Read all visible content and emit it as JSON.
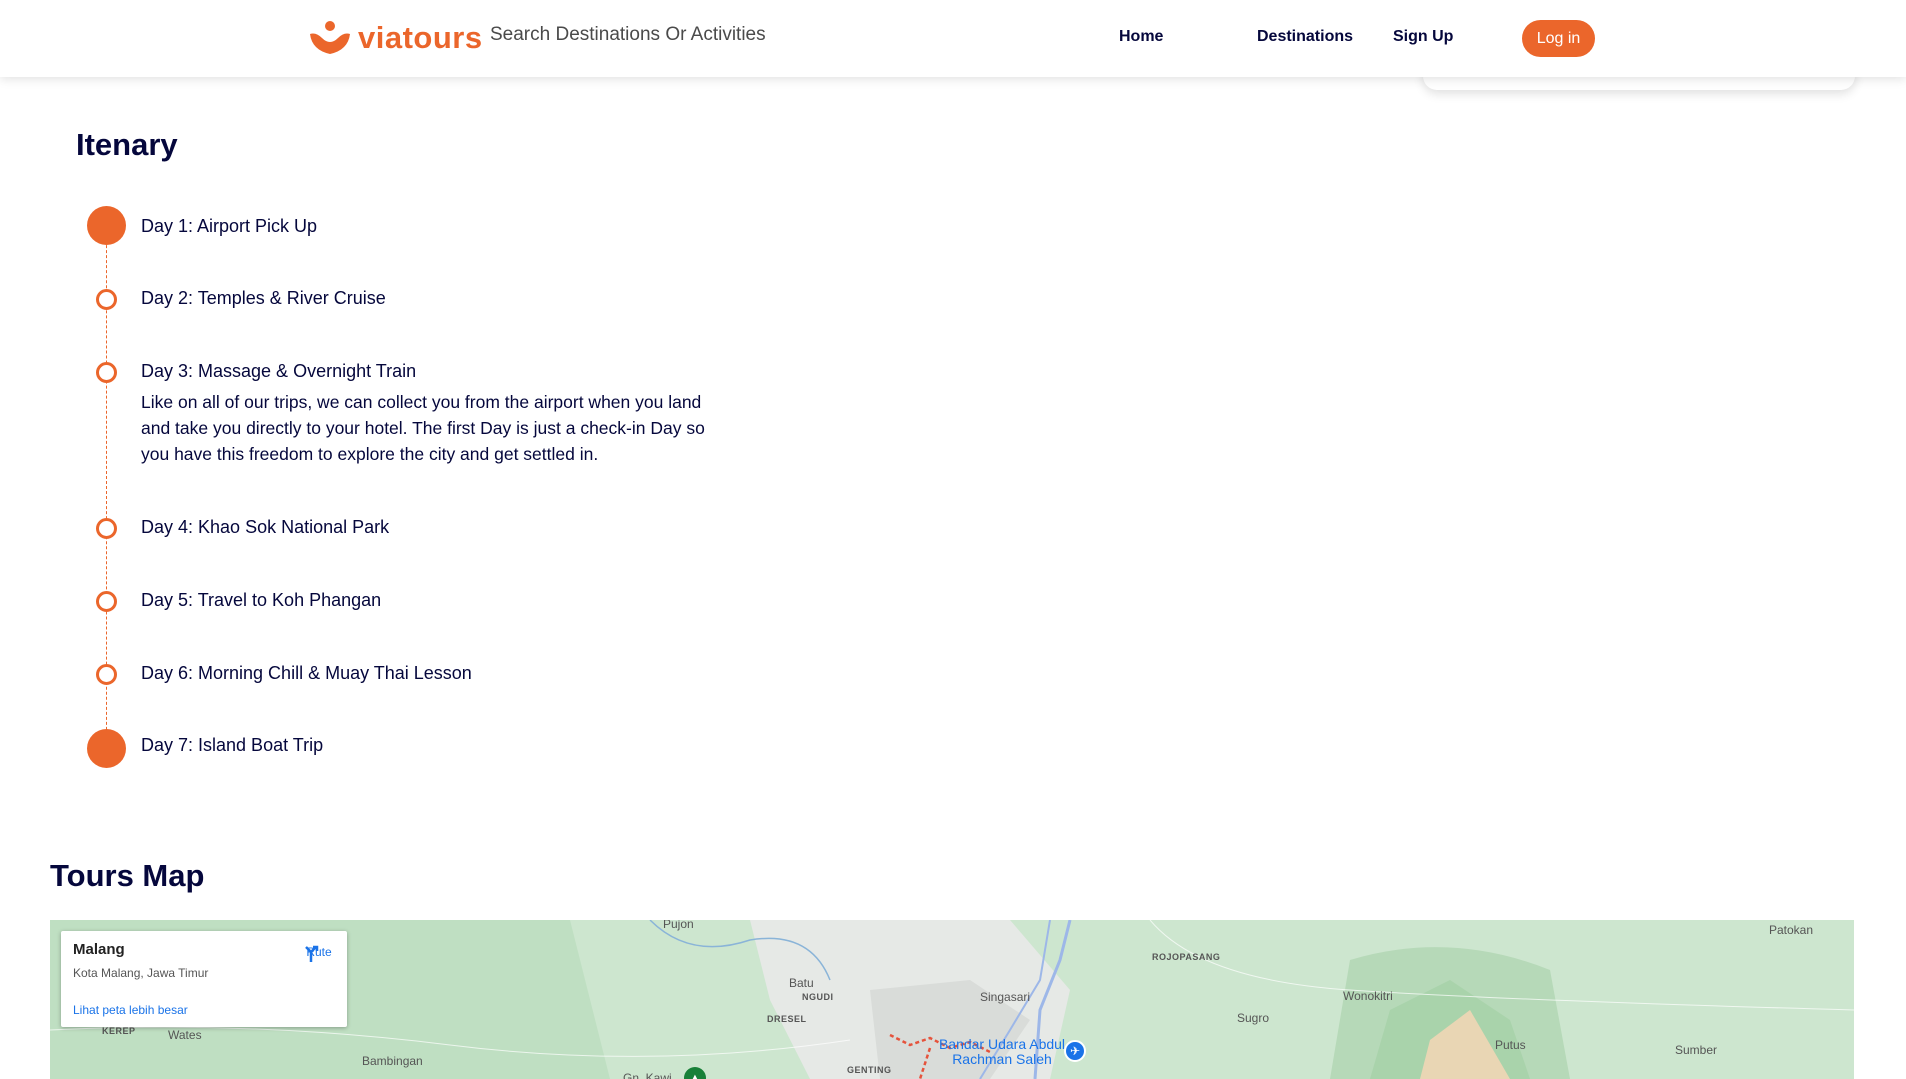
{
  "header": {
    "brand": "viatours",
    "search_placeholder": "Search Destinations Or Activities",
    "nav": [
      {
        "label": "Home"
      },
      {
        "label": "Destinations"
      },
      {
        "label": "Sign Up"
      }
    ],
    "login_label": "Log in"
  },
  "itinerary": {
    "title": "Itenary",
    "days": [
      {
        "label": "Day 1: Airport Pick Up",
        "marker": "filled"
      },
      {
        "label": "Day 2: Temples & River Cruise",
        "marker": "ring"
      },
      {
        "label": "Day 3: Massage & Overnight Train",
        "marker": "ring",
        "description": "Like on all of our trips, we can collect you from the airport when you land and take you directly to your hotel. The first Day is just a check-in Day so you have this freedom to explore the city and get settled in."
      },
      {
        "label": "Day 4: Khao Sok National Park",
        "marker": "ring"
      },
      {
        "label": "Day 5: Travel to Koh Phangan",
        "marker": "ring"
      },
      {
        "label": "Day 6: Morning Chill & Muay Thai Lesson",
        "marker": "ring"
      },
      {
        "label": "Day 7: Island Boat Trip",
        "marker": "filled"
      }
    ]
  },
  "map": {
    "title": "Tours Map",
    "place_card": {
      "name": "Malang",
      "region": "Kota Malang, Jawa Timur",
      "route_label": "Rute",
      "larger_map_link": "Lihat peta lebih besar"
    },
    "labels": {
      "pujon": "Pujon",
      "batu": "Batu",
      "ngudi": "NGUDI",
      "dresel": "DRESEL",
      "singasari": "Singasari",
      "rojopasang": "ROJOPASANG",
      "sugro": "Sugro",
      "wonokitri": "Wonokitri",
      "patokan": "Patokan",
      "putus": "Putus",
      "sumber": "Sumber",
      "kerep": "KEREP",
      "wates": "Wates",
      "bambingan": "Bambingan",
      "genting": "GENTING",
      "gn_kawi": "Gn. Kawi",
      "airport": "Bandar Udara Abdul Rachman Saleh"
    }
  },
  "colors": {
    "accent": "#eb662b",
    "text_dark": "#05073c",
    "map_link": "#1a73e8"
  }
}
